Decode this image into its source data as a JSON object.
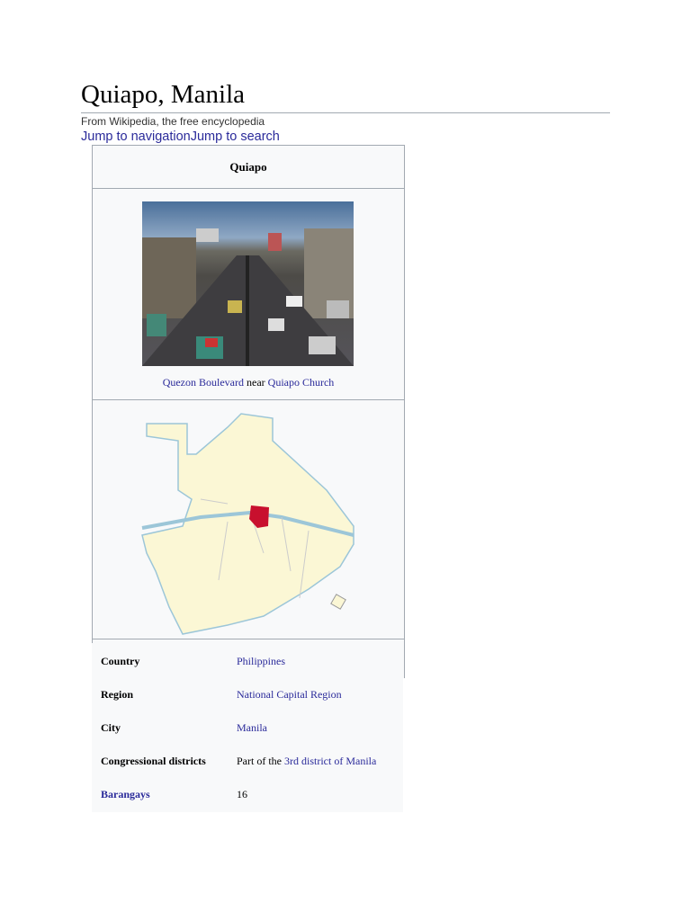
{
  "page": {
    "title": "Quiapo, Manila",
    "subtitle": "From Wikipedia, the free encyclopedia",
    "jump_nav": "Jump to navigation",
    "jump_search": "Jump to search"
  },
  "infobox": {
    "name": "Quiapo",
    "caption": {
      "link1": "Quezon Boulevard",
      "middle": " near ",
      "link2": "Quiapo Church"
    },
    "map_highlight_color": "#c8102e",
    "rows": [
      {
        "label": "Country",
        "value": "Philippines"
      },
      {
        "label": "Region",
        "value": "National Capital Region"
      },
      {
        "label": "City",
        "value": "Manila"
      },
      {
        "label": "Congressional districts",
        "prefix": "Part of the ",
        "value": "3rd district of Manila"
      },
      {
        "label": "Barangays",
        "value": "16"
      }
    ]
  }
}
